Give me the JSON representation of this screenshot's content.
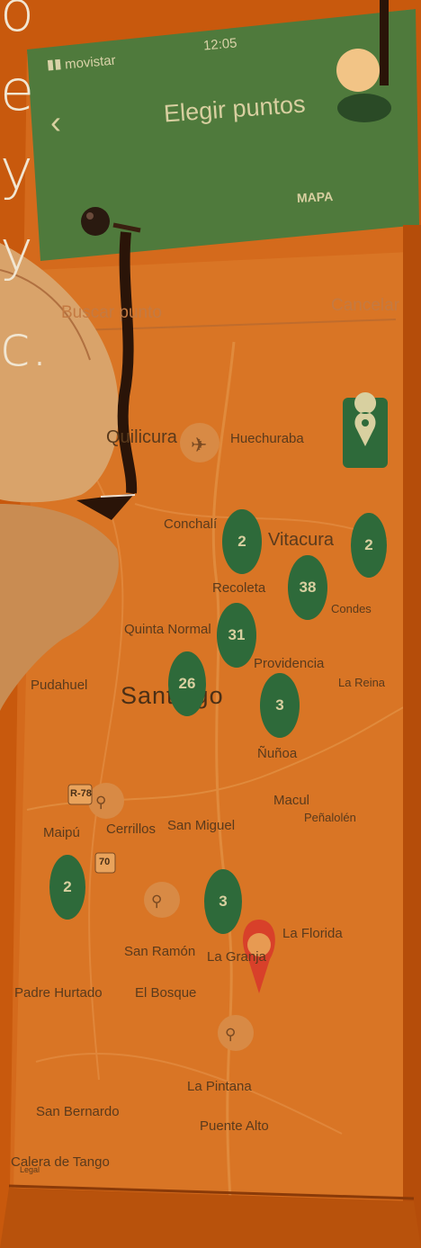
{
  "status_bar": {
    "carrier": "movistar",
    "time": "12:05"
  },
  "header": {
    "title": "Elegir puntos",
    "tab": "MAPA"
  },
  "search": {
    "placeholder": "Buscar punto",
    "cancel": "Cancelar"
  },
  "background_text_fragments": [
    "o",
    "e",
    "y",
    "y",
    "c."
  ],
  "map": {
    "places": [
      "Quilicura",
      "Huechuraba",
      "Conchalí",
      "Vitacura",
      "Recoleta",
      "Condes",
      "Quinta Normal",
      "Providencia",
      "La Reina",
      "Pudahuel",
      "Santiago",
      "Ñuñoa",
      "Macul",
      "Peñalolén",
      "Maipú",
      "Cerrillos",
      "San Miguel",
      "San Ramón",
      "La Granja",
      "La Florida",
      "El Bosque",
      "Padre Hurtado",
      "La Pintana",
      "Puente Alto",
      "San Bernardo",
      "Calera de Tango",
      "Legal"
    ],
    "clusters": [
      "2",
      "38",
      "2",
      "31",
      "26",
      "3",
      "2",
      "3"
    ],
    "road_badges": [
      "R-78",
      "70"
    ]
  },
  "colors": {
    "tint": "#c5580c",
    "header": "#4f7a3c",
    "cluster": "#2e6a3a"
  }
}
